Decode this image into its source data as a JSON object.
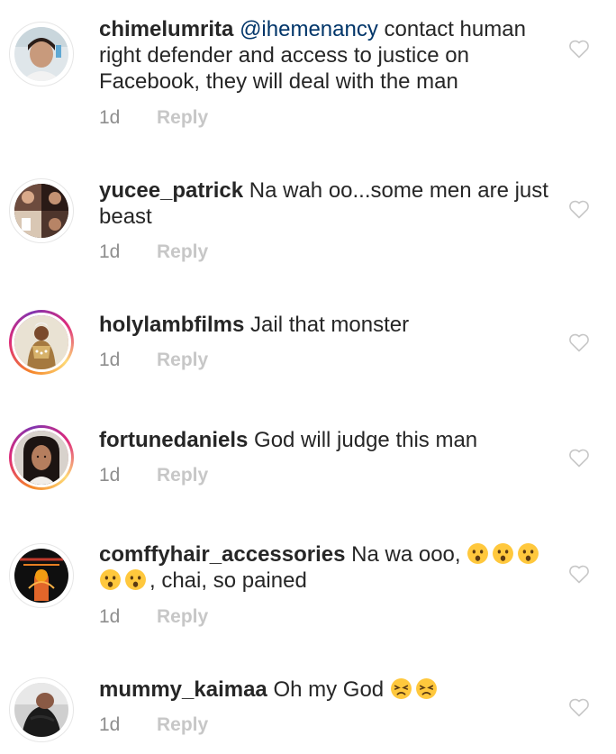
{
  "comments": [
    {
      "username": "chimelumrita",
      "mention": "@ihemenancy",
      "text": " contact human right defender and access to justice on Facebook, they will deal with the man",
      "time": "1d",
      "reply": "Reply",
      "has_story": false
    },
    {
      "username": "yucee_patrick",
      "text": " Na wah oo...some men are just beast",
      "time": "1d",
      "reply": "Reply",
      "has_story": false
    },
    {
      "username": "holylambfilms",
      "text": " Jail that monster",
      "time": "1d",
      "reply": "Reply",
      "has_story": true
    },
    {
      "username": "fortunedaniels",
      "text": " God will judge this man",
      "time": "1d",
      "reply": "Reply",
      "has_story": true
    },
    {
      "username": "comffyhair_accessories",
      "text_before": " Na wa ooo, ",
      "text_after": ", chai, so pained",
      "emoji_before": [
        "hushed-face",
        "hushed-face",
        "hushed-face"
      ],
      "emoji_wrapped": [
        "hushed-face",
        "hushed-face"
      ],
      "time": "1d",
      "reply": "Reply",
      "has_story": false
    },
    {
      "username": "mummy_kaimaa",
      "text": " Oh my God ",
      "emoji": [
        "persevering-face",
        "persevering-face"
      ],
      "time": "1d",
      "reply": "Reply",
      "has_story": false
    }
  ],
  "colors": {
    "text": "#262626",
    "mention": "#003569",
    "timestamp": "#8e8e8e",
    "reply": "#c7c7c7",
    "heart": "#c7c7c7",
    "story_ring": [
      "#f58529",
      "#dd2a7b",
      "#8134af",
      "#feda77"
    ]
  },
  "icons": {
    "like": "heart-outline-icon"
  }
}
